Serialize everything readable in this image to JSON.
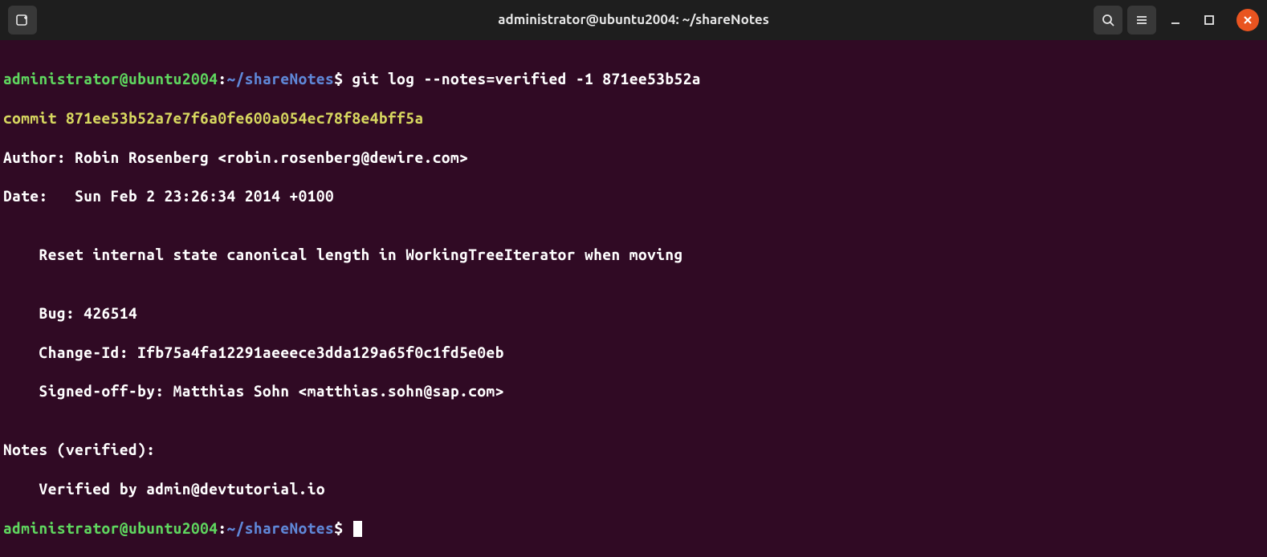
{
  "window": {
    "title": "administrator@ubuntu2004: ~/shareNotes"
  },
  "terminal": {
    "prompt1_user": "administrator@ubuntu2004",
    "prompt1_sep": ":",
    "prompt1_path": "~/shareNotes",
    "prompt1_dollar": "$ ",
    "command1": "git log --notes=verified -1 871ee53b52a",
    "commit_line": "commit 871ee53b52a7e7f6a0fe600a054ec78f8e4bff5a",
    "author_line": "Author: Robin Rosenberg <robin.rosenberg@dewire.com>",
    "date_line": "Date:   Sun Feb 2 23:26:34 2014 +0100",
    "blank1": "",
    "msg_line1": "    Reset internal state canonical length in WorkingTreeIterator when moving",
    "blank2": "",
    "msg_line2": "    Bug: 426514",
    "msg_line3": "    Change-Id: Ifb75a4fa12291aeeece3dda129a65f0c1fd5e0eb",
    "msg_line4": "    Signed-off-by: Matthias Sohn <matthias.sohn@sap.com>",
    "blank3": "",
    "notes_header": "Notes (verified):",
    "notes_body": "    Verified by admin@devtutorial.io",
    "prompt2_user": "administrator@ubuntu2004",
    "prompt2_sep": ":",
    "prompt2_path": "~/shareNotes",
    "prompt2_dollar": "$ "
  }
}
